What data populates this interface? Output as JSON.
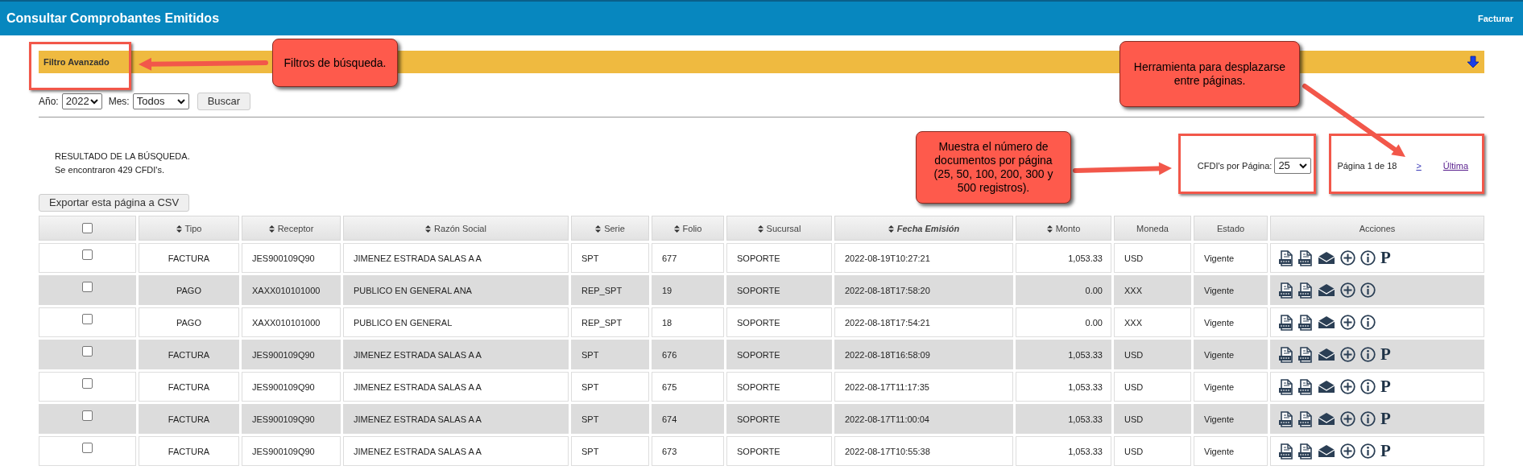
{
  "header": {
    "title": "Consultar Comprobantes Emitidos",
    "link": "Facturar"
  },
  "filter_bar": {
    "label": "Filtro Avanzado"
  },
  "filters": [
    {
      "label": "Año:",
      "value": "2022"
    },
    {
      "label": "Mes:",
      "value": "Todos"
    }
  ],
  "search_button": "Buscar",
  "result": {
    "title": "RESULTADO DE LA BÚSQUEDA.",
    "count": "Se encontraron 429 CFDI's."
  },
  "per_page": {
    "label": "CFDI's por Página:",
    "value": "25"
  },
  "pagination": {
    "info": "Página 1 de 18",
    "next": ">",
    "last": "Última"
  },
  "export_button": "Exportar esta página a CSV",
  "table": {
    "select_all_checked": false,
    "columns": [
      {
        "label": "Tipo",
        "sortable": true,
        "italic": false
      },
      {
        "label": "Receptor",
        "sortable": true,
        "italic": false
      },
      {
        "label": "Razón Social",
        "sortable": true,
        "italic": false
      },
      {
        "label": "Serie",
        "sortable": true,
        "italic": false
      },
      {
        "label": "Folio",
        "sortable": true,
        "italic": false
      },
      {
        "label": "Sucursal",
        "sortable": true,
        "italic": false
      },
      {
        "label": "Fecha Emisión",
        "sortable": true,
        "italic": true
      },
      {
        "label": "Monto",
        "sortable": true,
        "italic": false
      },
      {
        "label": "Moneda",
        "sortable": false,
        "italic": false
      },
      {
        "label": "Estado",
        "sortable": false,
        "italic": false
      },
      {
        "label": "Acciones",
        "sortable": false,
        "italic": false
      }
    ],
    "rows": [
      {
        "checked": false,
        "cells": [
          "FACTURA",
          "JES900109Q90",
          "JIMENEZ ESTRADA SALAS A A",
          "SPT",
          "677",
          "SOPORTE",
          "2022-08-19T10:27:21",
          "1,053.33",
          "USD",
          "Vigente"
        ],
        "actions": [
          {
            "kind": "xml"
          },
          {
            "kind": "pdf"
          },
          {
            "kind": "mail"
          },
          {
            "kind": "plus"
          },
          {
            "kind": "info"
          },
          {
            "kind": "glyph",
            "text": "P"
          }
        ]
      },
      {
        "checked": false,
        "cells": [
          "PAGO",
          "XAXX010101000",
          "PUBLICO EN GENERAL ANA",
          "REP_SPT",
          "19",
          "SOPORTE",
          "2022-08-18T17:58:20",
          "0.00",
          "XXX",
          "Vigente"
        ],
        "actions": [
          {
            "kind": "xml"
          },
          {
            "kind": "pdf"
          },
          {
            "kind": "mail"
          },
          {
            "kind": "plus"
          },
          {
            "kind": "info"
          }
        ]
      },
      {
        "checked": false,
        "cells": [
          "PAGO",
          "XAXX010101000",
          "PUBLICO EN GENERAL",
          "REP_SPT",
          "18",
          "SOPORTE",
          "2022-08-18T17:54:21",
          "0.00",
          "XXX",
          "Vigente"
        ],
        "actions": [
          {
            "kind": "xml"
          },
          {
            "kind": "pdf"
          },
          {
            "kind": "mail"
          },
          {
            "kind": "plus"
          },
          {
            "kind": "info"
          }
        ]
      },
      {
        "checked": false,
        "cells": [
          "FACTURA",
          "JES900109Q90",
          "JIMENEZ ESTRADA SALAS A A",
          "SPT",
          "676",
          "SOPORTE",
          "2022-08-18T16:58:09",
          "1,053.33",
          "USD",
          "Vigente"
        ],
        "actions": [
          {
            "kind": "xml"
          },
          {
            "kind": "pdf"
          },
          {
            "kind": "mail"
          },
          {
            "kind": "plus"
          },
          {
            "kind": "info"
          },
          {
            "kind": "glyph",
            "text": "P"
          }
        ]
      },
      {
        "checked": false,
        "cells": [
          "FACTURA",
          "JES900109Q90",
          "JIMENEZ ESTRADA SALAS A A",
          "SPT",
          "675",
          "SOPORTE",
          "2022-08-17T11:17:35",
          "1,053.33",
          "USD",
          "Vigente"
        ],
        "actions": [
          {
            "kind": "xml"
          },
          {
            "kind": "pdf"
          },
          {
            "kind": "mail"
          },
          {
            "kind": "plus"
          },
          {
            "kind": "info"
          },
          {
            "kind": "glyph",
            "text": "P"
          }
        ]
      },
      {
        "checked": false,
        "cells": [
          "FACTURA",
          "JES900109Q90",
          "JIMENEZ ESTRADA SALAS A A",
          "SPT",
          "674",
          "SOPORTE",
          "2022-08-17T11:00:04",
          "1,053.33",
          "USD",
          "Vigente"
        ],
        "actions": [
          {
            "kind": "xml"
          },
          {
            "kind": "pdf"
          },
          {
            "kind": "mail"
          },
          {
            "kind": "plus"
          },
          {
            "kind": "info"
          },
          {
            "kind": "glyph",
            "text": "P"
          }
        ]
      },
      {
        "checked": false,
        "cells": [
          "FACTURA",
          "JES900109Q90",
          "JIMENEZ ESTRADA SALAS A A",
          "SPT",
          "673",
          "SOPORTE",
          "2022-08-17T10:55:38",
          "1,053.33",
          "USD",
          "Vigente"
        ],
        "actions": [
          {
            "kind": "xml"
          },
          {
            "kind": "pdf"
          },
          {
            "kind": "mail"
          },
          {
            "kind": "plus"
          },
          {
            "kind": "info"
          },
          {
            "kind": "glyph",
            "text": "P"
          }
        ]
      }
    ]
  },
  "callouts": [
    {
      "text": "Filtros de búsqueda."
    },
    {
      "text": "Herramienta para desplazarse entre páginas."
    },
    {
      "text": "Muestra el número de documentos por página (25, 50, 100, 200, 300 y 500 registros)."
    }
  ]
}
